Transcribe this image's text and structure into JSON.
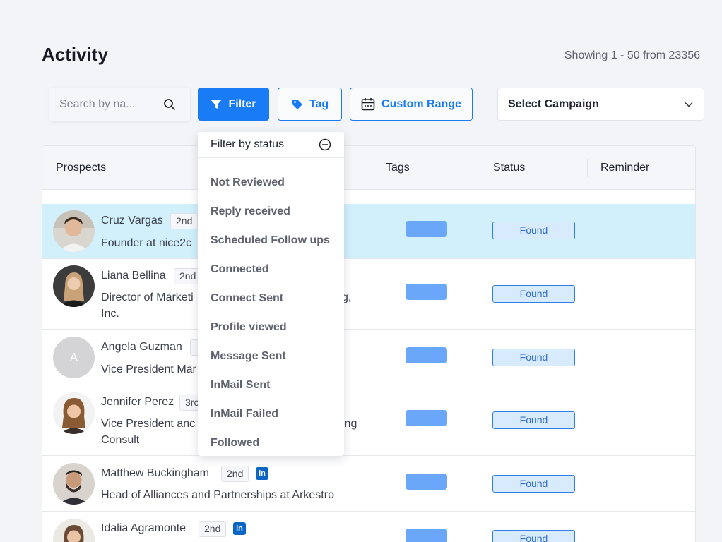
{
  "page": {
    "title": "Activity",
    "showing": "Showing 1 - 50 from 23356"
  },
  "toolbar": {
    "search_placeholder": "Search by na...",
    "filter_label": "Filter",
    "tag_label": "Tag",
    "range_label": "Custom Range",
    "campaign_label": "Select Campaign"
  },
  "table": {
    "headers": {
      "prospects": "Prospects",
      "tags": "Tags",
      "status": "Status",
      "reminder": "Reminder"
    },
    "rows": [
      {
        "name": "Cruz Vargas",
        "degree": "2nd",
        "linkedin": false,
        "title_lines": [
          "Founder at nice2c"
        ],
        "status": "Found",
        "avatar_initial": "",
        "selected": true
      },
      {
        "name": "Liana Bellina",
        "degree": "2nd",
        "linkedin": false,
        "title_lines": [
          "Director of Marketi",
          "Inc."
        ],
        "status": "Found",
        "avatar_initial": "",
        "selected": false
      },
      {
        "name": "Angela Guzman",
        "degree": "",
        "linkedin": false,
        "title_lines": [
          "Vice President Mar"
        ],
        "status": "Found",
        "avatar_initial": "A",
        "selected": false
      },
      {
        "name": "Jennifer Perez",
        "degree": "3rc",
        "linkedin": false,
        "title_lines": [
          "Vice President anc",
          "Consult"
        ],
        "status": "Found",
        "avatar_initial": "",
        "selected": false
      },
      {
        "name": "Matthew Buckingham",
        "degree": "2nd",
        "linkedin": true,
        "title_lines": [
          "Head of Alliances and Partnerships at Arkestro"
        ],
        "status": "Found",
        "avatar_initial": "",
        "selected": false
      },
      {
        "name": "Idalia Agramonte",
        "degree": "2nd",
        "linkedin": true,
        "title_lines": [],
        "status": "Found",
        "avatar_initial": "",
        "selected": false
      }
    ],
    "title_overflow": {
      "row2": "g,",
      "row4": "ing"
    }
  },
  "filter_menu": {
    "header": "Filter by status",
    "items": [
      "Not Reviewed",
      "Reply received",
      "Scheduled Follow ups",
      "Connected",
      "Connect Sent",
      "Profile viewed",
      "Message Sent",
      "InMail Sent",
      "InMail Failed",
      "Followed"
    ]
  },
  "colors": {
    "accent": "#1a7cf5",
    "selected_row": "#d2f0fc",
    "tag_pill": "#6aa7f8",
    "linkedin": "#0a66c2"
  }
}
